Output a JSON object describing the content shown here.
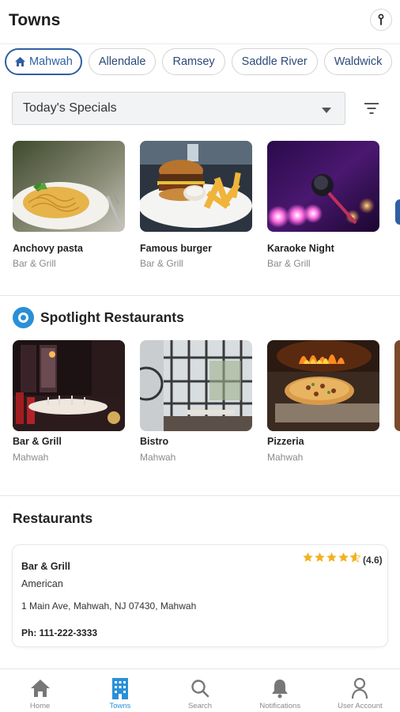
{
  "header": {
    "title": "Towns"
  },
  "towns": [
    {
      "label": "Mahwah",
      "active": true
    },
    {
      "label": "Allendale",
      "active": false
    },
    {
      "label": "Ramsey",
      "active": false
    },
    {
      "label": "Saddle River",
      "active": false
    },
    {
      "label": "Waldwick",
      "active": false
    }
  ],
  "specials_dropdown": {
    "value": "Today's Specials"
  },
  "specials": [
    {
      "name": "Anchovy pasta",
      "place": "Bar & Grill"
    },
    {
      "name": "Famous burger",
      "place": "Bar & Grill"
    },
    {
      "name": "Karaoke Night",
      "place": "Bar & Grill"
    }
  ],
  "spotlight": {
    "title": "Spotlight Restaurants",
    "items": [
      {
        "name": "Bar & Grill",
        "town": "Mahwah"
      },
      {
        "name": "Bistro",
        "town": "Mahwah"
      },
      {
        "name": "Pizzeria",
        "town": "Mahwah"
      }
    ]
  },
  "restaurants": {
    "title": "Restaurants",
    "items": [
      {
        "name": "Bar & Grill",
        "cuisine": "American",
        "address": "1 Main Ave, Mahwah, NJ 07430, Mahwah",
        "phone": "Ph: 111-222-3333",
        "rating_text": "(4.6)",
        "rating": 4.6
      }
    ]
  },
  "tabs": [
    {
      "label": "Home",
      "icon": "home-icon",
      "active": false
    },
    {
      "label": "Towns",
      "icon": "building-icon",
      "active": true
    },
    {
      "label": "Search",
      "icon": "search-icon",
      "active": false
    },
    {
      "label": "Notifications",
      "icon": "bell-icon",
      "active": false
    },
    {
      "label": "User Account",
      "icon": "user-icon",
      "active": false
    }
  ],
  "colors": {
    "accent": "#2f5fa5",
    "tab_active": "#2a90d8",
    "star": "#f2b21f"
  }
}
